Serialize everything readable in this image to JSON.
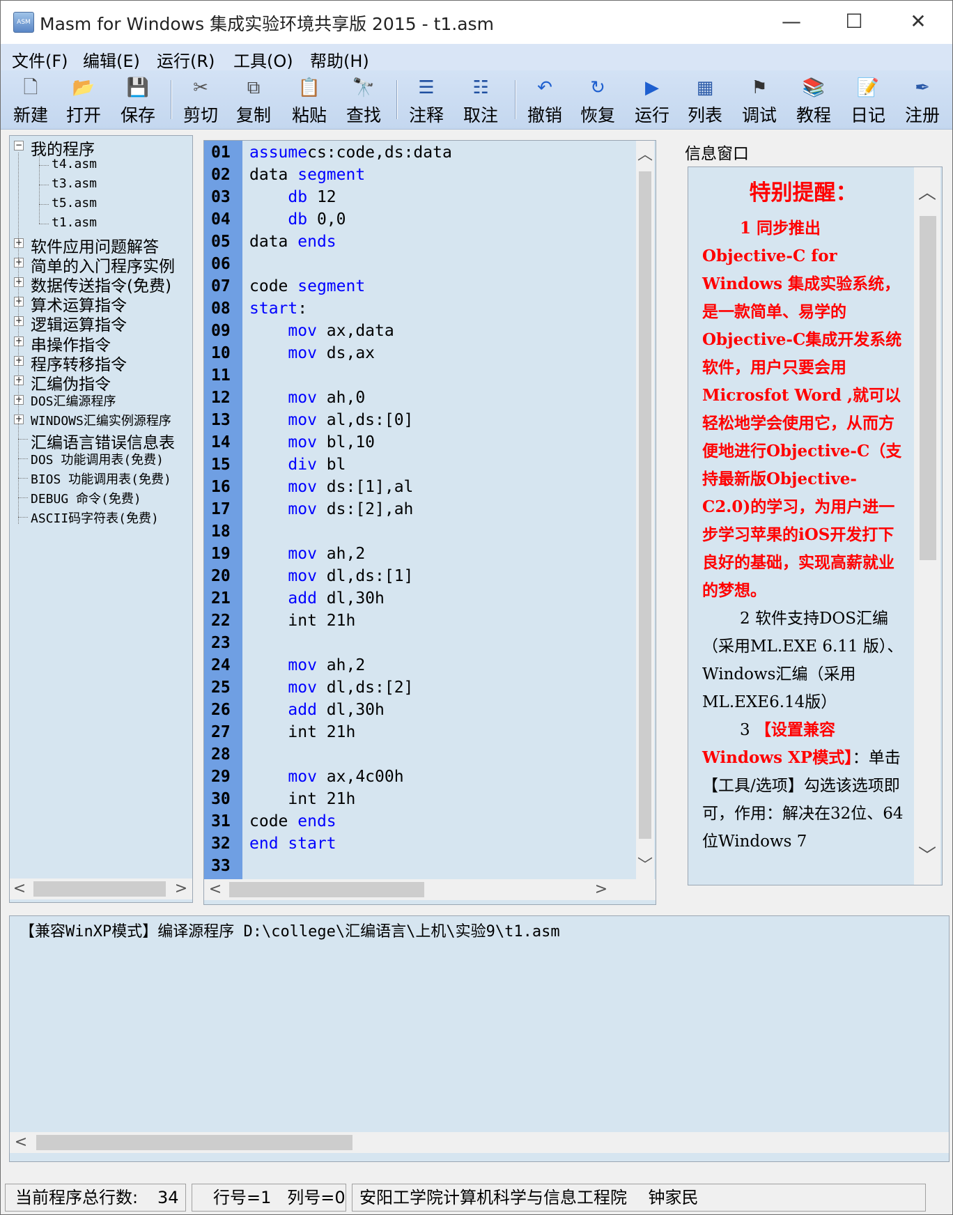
{
  "window": {
    "title": "Masm for Windows 集成实验环境共享版 2015 - t1.asm",
    "icon_label": "ASM",
    "controls": {
      "minimize": "—",
      "maximize": "☐",
      "close": "✕"
    }
  },
  "menu": [
    "文件(F)",
    "编辑(E)",
    "运行(R)",
    "工具(O)",
    "帮助(H)"
  ],
  "toolbar": [
    {
      "label": "新建",
      "icon": "new-file-icon",
      "glyph": "🗋"
    },
    {
      "label": "打开",
      "icon": "open-folder-icon",
      "glyph": "📂"
    },
    {
      "label": "保存",
      "icon": "save-icon",
      "glyph": "💾"
    },
    {
      "label": "剪切",
      "icon": "cut-icon",
      "glyph": "✂"
    },
    {
      "label": "复制",
      "icon": "copy-icon",
      "glyph": "⧉"
    },
    {
      "label": "粘贴",
      "icon": "paste-icon",
      "glyph": "📋"
    },
    {
      "label": "查找",
      "icon": "find-binoculars-icon",
      "glyph": "🔭"
    },
    {
      "label": "注释",
      "icon": "comment-icon",
      "glyph": "☰"
    },
    {
      "label": "取注",
      "icon": "uncomment-icon",
      "glyph": "☷"
    },
    {
      "label": "撤销",
      "icon": "undo-icon",
      "glyph": "↶"
    },
    {
      "label": "恢复",
      "icon": "redo-icon",
      "glyph": "↻"
    },
    {
      "label": "运行",
      "icon": "run-icon",
      "glyph": "▶"
    },
    {
      "label": "列表",
      "icon": "list-icon",
      "glyph": "▦"
    },
    {
      "label": "调试",
      "icon": "debug-icon",
      "glyph": "⚑"
    },
    {
      "label": "教程",
      "icon": "books-icon",
      "glyph": "📚"
    },
    {
      "label": "日记",
      "icon": "diary-icon",
      "glyph": "📝"
    },
    {
      "label": "注册",
      "icon": "register-pen-icon",
      "glyph": "✒"
    }
  ],
  "tree": {
    "root": "我的程序",
    "files": [
      "t4.asm",
      "t3.asm",
      "t5.asm",
      "t1.asm"
    ],
    "folders": [
      "软件应用问题解答",
      "简单的入门程序实例",
      "数据传送指令(免费)",
      "算术运算指令",
      "逻辑运算指令",
      "串操作指令",
      "程序转移指令",
      "汇编伪指令",
      "DOS汇编源程序",
      "WINDOWS汇编实例源程序"
    ],
    "leaves": [
      "汇编语言错误信息表",
      "DOS 功能调用表(免费)",
      "BIOS 功能调用表(免费)",
      "DEBUG 命令(免费)",
      "ASCII码字符表(免费)"
    ]
  },
  "editor": {
    "lines": [
      {
        "n": "01",
        "t": [
          [
            "kw",
            "assume"
          ],
          [
            "",
            "cs:code,ds:data"
          ]
        ]
      },
      {
        "n": "02",
        "t": [
          [
            "",
            "data "
          ],
          [
            "kw",
            "segment"
          ]
        ]
      },
      {
        "n": "03",
        "t": [
          [
            "",
            "    "
          ],
          [
            "kw",
            "db"
          ],
          [
            "",
            " 12"
          ]
        ]
      },
      {
        "n": "04",
        "t": [
          [
            "",
            "    "
          ],
          [
            "kw",
            "db"
          ],
          [
            "",
            " 0,0"
          ]
        ]
      },
      {
        "n": "05",
        "t": [
          [
            "",
            "data "
          ],
          [
            "kw",
            "ends"
          ]
        ]
      },
      {
        "n": "06",
        "t": []
      },
      {
        "n": "07",
        "t": [
          [
            "",
            "code "
          ],
          [
            "kw",
            "segment"
          ]
        ]
      },
      {
        "n": "08",
        "t": [
          [
            "kw",
            "start"
          ],
          [
            "",
            ":"
          ]
        ]
      },
      {
        "n": "09",
        "t": [
          [
            "",
            "    "
          ],
          [
            "kw",
            "mov"
          ],
          [
            "",
            " ax,data"
          ]
        ]
      },
      {
        "n": "10",
        "t": [
          [
            "",
            "    "
          ],
          [
            "kw",
            "mov"
          ],
          [
            "",
            " ds,ax"
          ]
        ]
      },
      {
        "n": "11",
        "t": []
      },
      {
        "n": "12",
        "t": [
          [
            "",
            "    "
          ],
          [
            "kw",
            "mov"
          ],
          [
            "",
            " ah,0"
          ]
        ]
      },
      {
        "n": "13",
        "t": [
          [
            "",
            "    "
          ],
          [
            "kw",
            "mov"
          ],
          [
            "",
            " al,ds:[0]"
          ]
        ]
      },
      {
        "n": "14",
        "t": [
          [
            "",
            "    "
          ],
          [
            "kw",
            "mov"
          ],
          [
            "",
            " bl,10"
          ]
        ]
      },
      {
        "n": "15",
        "t": [
          [
            "",
            "    "
          ],
          [
            "kw",
            "div"
          ],
          [
            "",
            " bl"
          ]
        ]
      },
      {
        "n": "16",
        "t": [
          [
            "",
            "    "
          ],
          [
            "kw",
            "mov"
          ],
          [
            "",
            " ds:[1],al"
          ]
        ]
      },
      {
        "n": "17",
        "t": [
          [
            "",
            "    "
          ],
          [
            "kw",
            "mov"
          ],
          [
            "",
            " ds:[2],ah"
          ]
        ]
      },
      {
        "n": "18",
        "t": []
      },
      {
        "n": "19",
        "t": [
          [
            "",
            "    "
          ],
          [
            "kw",
            "mov"
          ],
          [
            "",
            " ah,2"
          ]
        ]
      },
      {
        "n": "20",
        "t": [
          [
            "",
            "    "
          ],
          [
            "kw",
            "mov"
          ],
          [
            "",
            " dl,ds:[1]"
          ]
        ]
      },
      {
        "n": "21",
        "t": [
          [
            "",
            "    "
          ],
          [
            "kw",
            "add"
          ],
          [
            "",
            " dl,30h"
          ]
        ]
      },
      {
        "n": "22",
        "t": [
          [
            "",
            "    int 21h"
          ]
        ]
      },
      {
        "n": "23",
        "t": []
      },
      {
        "n": "24",
        "t": [
          [
            "",
            "    "
          ],
          [
            "kw",
            "mov"
          ],
          [
            "",
            " ah,2"
          ]
        ]
      },
      {
        "n": "25",
        "t": [
          [
            "",
            "    "
          ],
          [
            "kw",
            "mov"
          ],
          [
            "",
            " dl,ds:[2]"
          ]
        ]
      },
      {
        "n": "26",
        "t": [
          [
            "",
            "    "
          ],
          [
            "kw",
            "add"
          ],
          [
            "",
            " dl,30h"
          ]
        ]
      },
      {
        "n": "27",
        "t": [
          [
            "",
            "    int 21h"
          ]
        ]
      },
      {
        "n": "28",
        "t": []
      },
      {
        "n": "29",
        "t": [
          [
            "",
            "    "
          ],
          [
            "kw",
            "mov"
          ],
          [
            "",
            " ax,4c00h"
          ]
        ]
      },
      {
        "n": "30",
        "t": [
          [
            "",
            "    int 21h"
          ]
        ]
      },
      {
        "n": "31",
        "t": [
          [
            "",
            "code "
          ],
          [
            "kw",
            "ends"
          ]
        ]
      },
      {
        "n": "32",
        "t": [
          [
            "kw",
            "end"
          ],
          [
            "",
            " "
          ],
          [
            "kw",
            "start"
          ]
        ]
      },
      {
        "n": "33",
        "t": []
      }
    ]
  },
  "info": {
    "label": "信息窗口",
    "heading": "特别提醒：",
    "p1_title": "1  同步推出",
    "p1_body": "Objective-C for Windows 集成实验系统，是一款简单、易学的Objective-C集成开发系统软件，用户只要会用Microsfot Word ,就可以轻松地学会使用它，从而方便地进行Objective-C（支持最新版Objective-C2.0)的学习，为用户进一步学习苹果的iOS开发打下良好的基础，实现高薪就业的梦想。",
    "p2": "2 软件支持DOS汇编（采用ML.EXE 6.11 版）、Windows汇编（采用ML.EXE6.14版）",
    "p3_num": "3 ",
    "p3_red": "【设置兼容 Windows XP模式】",
    "p3_black": "：单击【工具/选项】勾选该选项即可，作用：解决在32位、64位Windows 7"
  },
  "output": {
    "text": "【兼容WinXP模式】编译源程序 D:\\college\\汇编语言\\上机\\实验9\\t1.asm"
  },
  "status": {
    "total_lines_label": "当前程序总行数:",
    "total_lines": "34",
    "position": "行号=1   列号=0",
    "author": "安阳工学院计算机科学与信息工程院    钟家民"
  },
  "scroll": {
    "left": "<",
    "right": ">",
    "up": "︿",
    "down": "﹀"
  },
  "colors": {
    "gutter": "#6f9fe3",
    "keyword": "#0000ff",
    "panel_bg": "#d6e5f0",
    "notice_red": "#ff0000"
  }
}
